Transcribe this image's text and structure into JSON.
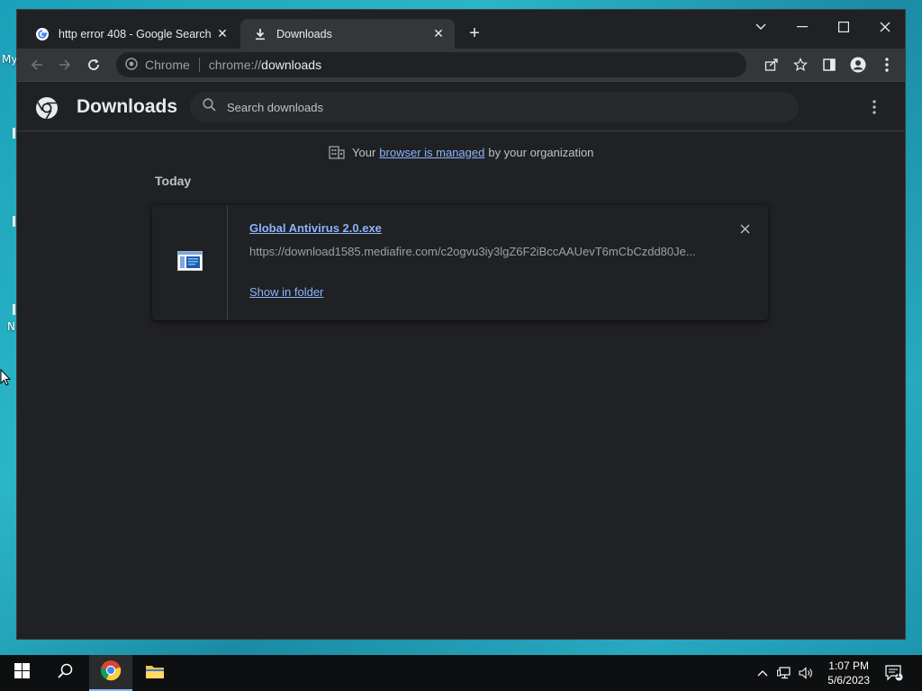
{
  "desktop": {
    "label_fragments": [
      "My",
      "N"
    ]
  },
  "browser": {
    "tabs": [
      {
        "title": "http error 408 - Google Search",
        "favicon": "google-g-icon",
        "active": false
      },
      {
        "title": "Downloads",
        "favicon": "download-icon",
        "active": true
      }
    ],
    "omnibox": {
      "site_label": "Chrome",
      "url_scheme": "chrome://",
      "url_host": "downloads"
    }
  },
  "downloads_page": {
    "title": "Downloads",
    "search_placeholder": "Search downloads",
    "managed": {
      "prefix": "Your",
      "link": "browser is managed",
      "suffix": "by your organization"
    },
    "section_label": "Today",
    "items": [
      {
        "filename": "Global Antivirus 2.0.exe",
        "url": "https://download1585.mediafire.com/c2ogvu3iy3lgZ6F2iBccAAUevT6mCbCzdd80Je...",
        "action": "Show in folder"
      }
    ]
  },
  "taskbar": {
    "time": "1:07 PM",
    "date": "5/6/2023",
    "notification_count": "1"
  },
  "colors": {
    "accent": "#8ab4f8",
    "background": "#202124",
    "toolbar": "#35363a"
  }
}
